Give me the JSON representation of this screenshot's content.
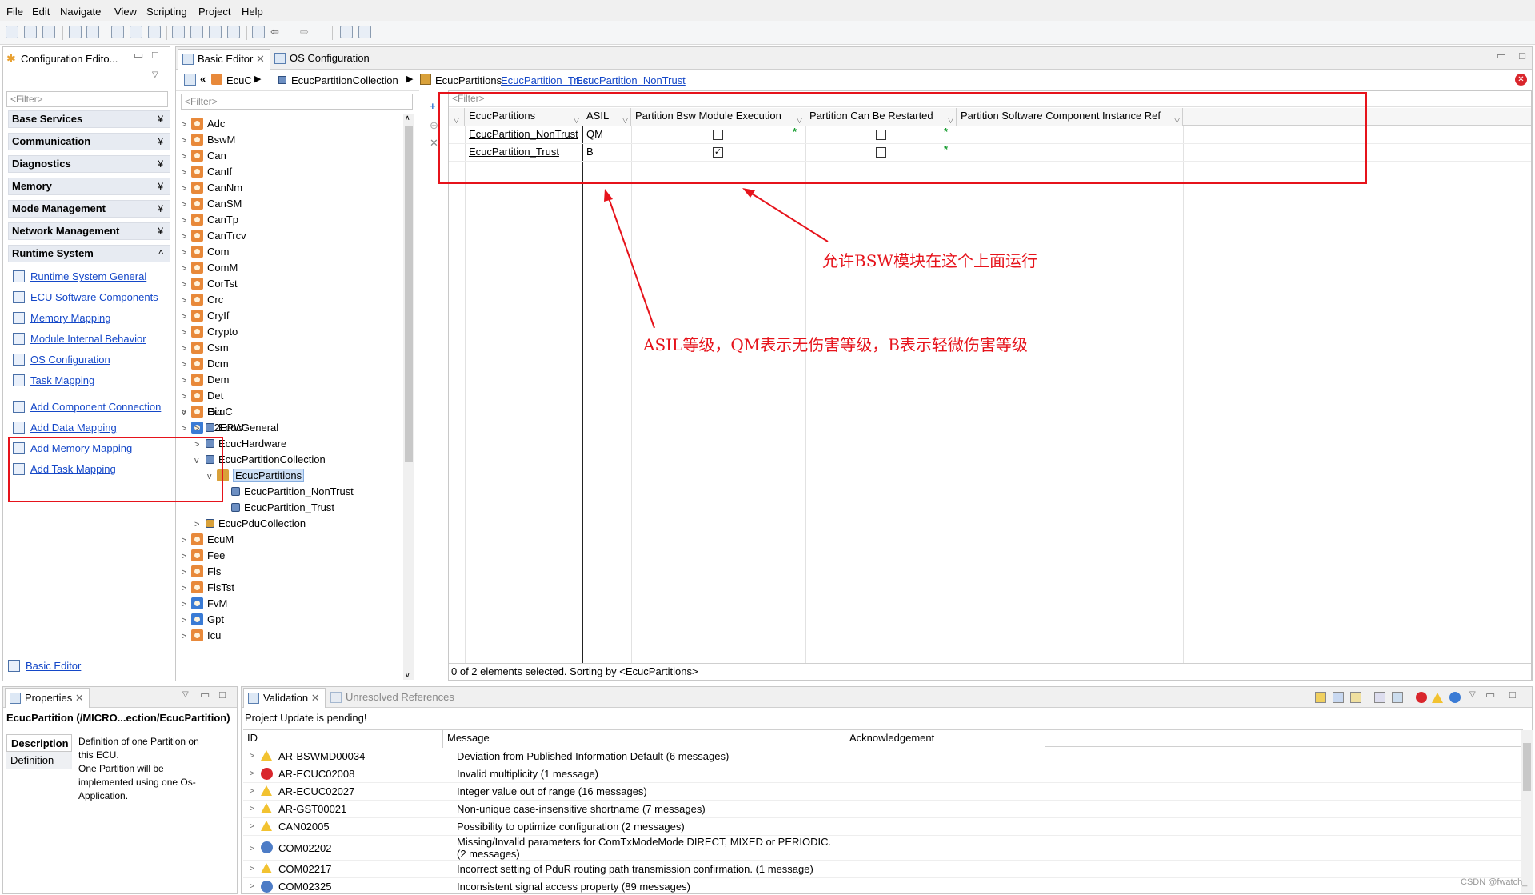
{
  "menu": [
    "File",
    "Edit",
    "Navigate",
    "View",
    "Scripting",
    "Project",
    "Help"
  ],
  "config_editor": {
    "title": "Configuration Edito...",
    "filter_placeholder": "<Filter>",
    "categories": [
      "Base Services",
      "Communication",
      "Diagnostics",
      "Memory",
      "Mode Management",
      "Network Management",
      "Runtime System"
    ],
    "runtime_links": [
      "Runtime System General",
      "ECU Software Components",
      "Memory Mapping",
      "Module Internal Behavior",
      "OS Configuration",
      "Task Mapping"
    ],
    "action_links": [
      "Add Component Connection",
      "Add Data Mapping",
      "Add Memory Mapping",
      "Add Task Mapping"
    ],
    "footer_link": "Basic Editor"
  },
  "editor_tabs": [
    "Basic Editor",
    "OS Configuration"
  ],
  "breadcrumb": {
    "items": [
      "EcuC",
      "EcucPartitionCollection",
      "EcucPartitions"
    ],
    "links": [
      "EcucPartition_Trust",
      "EcucPartition_NonTrust"
    ]
  },
  "tree": {
    "filter_placeholder": "<Filter>",
    "top": [
      "Adc",
      "BswM",
      "Can",
      "CanIf",
      "CanNm",
      "CanSM",
      "CanTp",
      "CanTrcv",
      "Com",
      "ComM",
      "CorTst",
      "Crc",
      "CryIf",
      "Crypto",
      "Csm",
      "Dcm",
      "Dem",
      "Det",
      "Dio",
      "E2EPW",
      "EcuC"
    ],
    "ecuc_children": [
      "EcucGeneral",
      "EcucHardware",
      "EcucPartitionCollection"
    ],
    "partitions": "EcucPartitions",
    "partition_items": [
      "EcucPartition_NonTrust",
      "EcucPartition_Trust"
    ],
    "pdu": "EcucPduCollection",
    "bottom": [
      "EcuM",
      "Fee",
      "Fls",
      "FlsTst",
      "FvM",
      "Gpt",
      "Icu"
    ]
  },
  "table": {
    "filter_placeholder": "<Filter>",
    "headers": [
      "EcucPartitions",
      "ASIL",
      "Partition Bsw Module Execution",
      "Partition Can Be Restarted",
      "Partition Software Component Instance Ref"
    ],
    "rows": [
      {
        "name": "EcucPartition_NonTrust",
        "asil": "QM",
        "bsw": false,
        "restart": false
      },
      {
        "name": "EcucPartition_Trust",
        "asil": "B",
        "bsw": true,
        "restart": false
      }
    ],
    "status": "0 of 2 elements selected. Sorting by <EcucPartitions>"
  },
  "annotations": {
    "bsw_note": "允许BSW模块在这个上面运行",
    "asil_note": "ASIL等级，QM表示无伤害等级，B表示轻微伤害等级"
  },
  "properties": {
    "tab": "Properties",
    "title": "EcucPartition (/MICRO...ection/EcucPartition)",
    "sections": [
      "Description",
      "Definition"
    ],
    "desc_lines": [
      "Definition of one Partition on",
      "this ECU.",
      "One Partition will be",
      "implemented using one Os-",
      "Application."
    ]
  },
  "validation": {
    "tabs": [
      "Validation",
      "Unresolved References"
    ],
    "pending": "Project Update is pending!",
    "headers": [
      "ID",
      "Message",
      "Acknowledgement"
    ],
    "rows": [
      {
        "icon": "warn-gear",
        "id": "AR-BSWMD00034",
        "msg": "Deviation from Published Information Default (6 messages)"
      },
      {
        "icon": "error",
        "id": "AR-ECUC02008",
        "msg": "Invalid multiplicity (1 message)"
      },
      {
        "icon": "warn-gear",
        "id": "AR-ECUC02027",
        "msg": "Integer value out of range (16 messages)"
      },
      {
        "icon": "warn",
        "id": "AR-GST00021",
        "msg": "Non-unique case-insensitive shortname (7 messages)"
      },
      {
        "icon": "warn",
        "id": "CAN02005",
        "msg": "Possibility to optimize configuration (2 messages)"
      },
      {
        "icon": "gear",
        "id": "COM02202",
        "msg": "Missing/Invalid parameters for ComTxModeMode DIRECT, MIXED or PERIODIC.",
        "msg2": "(2 messages)"
      },
      {
        "icon": "warn-gear",
        "id": "COM02217",
        "msg": "Incorrect setting of PduR routing path transmission confirmation. (1 message)"
      },
      {
        "icon": "gear",
        "id": "COM02325",
        "msg": "Inconsistent signal access property (89 messages)"
      }
    ]
  },
  "watermark": "CSDN @fwatch_"
}
